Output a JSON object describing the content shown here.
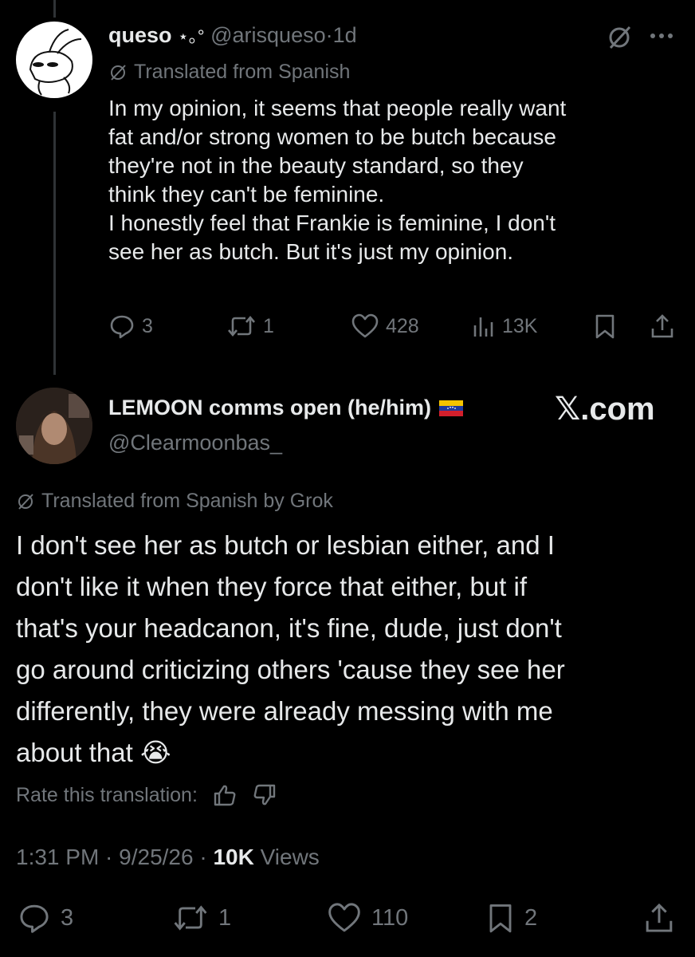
{
  "post": {
    "display_name": "queso",
    "name_decoration": "⋆｡°",
    "handle": "@arisqueso",
    "separator": "·",
    "time": "1d",
    "translated_label": "Translated from Spanish",
    "lines": [
      "In my opinion, it seems that people really want",
      "fat and/or strong women to be butch because",
      "they're not in the beauty standard, so they",
      "think they can't be feminine.",
      "I honestly feel that Frankie is feminine, I don't",
      "see her as butch. But it's just my opinion."
    ],
    "replies": "3",
    "reposts": "1",
    "likes": "428",
    "views": "13K"
  },
  "reply": {
    "display_name": "LEMOON comms open (he/him)",
    "handle": "@Clearmoonbas_",
    "watermark": "𝕏.com",
    "translated_label": "Translated from Spanish by Grok",
    "lines": [
      "I don't see her as butch or lesbian either, and I",
      "don't like it when they force that either, but if",
      "that's your headcanon, it's fine, dude, just don't",
      "go around criticizing others 'cause they see her",
      "differently, they were already messing with me",
      "about that 😭"
    ],
    "rate_label": "Rate this translation:",
    "timestamp": "1:31 PM · 9/25/26 ·",
    "views_count": "10K",
    "views_label": "Views",
    "replies": "3",
    "reposts": "1",
    "likes": "110",
    "bookmarks": "2"
  },
  "colors": {
    "background": "#000000",
    "text": "#e7e9ea",
    "muted": "#71767b",
    "flag_yellow": "#f5c400",
    "flag_blue": "#1e3a9e",
    "flag_red": "#d21f2c"
  }
}
